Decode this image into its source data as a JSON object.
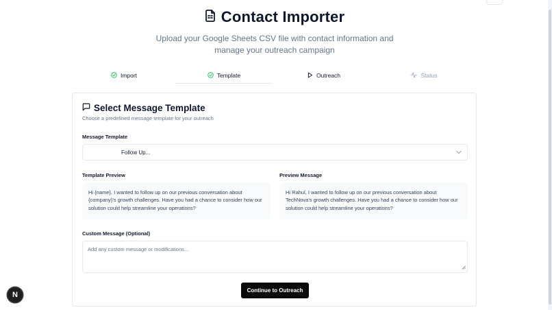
{
  "header": {
    "title": "Contact Importer",
    "title_icon": "file-text-icon",
    "subtitle": "Upload your Google Sheets CSV file with contact information and manage your outreach campaign"
  },
  "steps": [
    {
      "label": "Import",
      "icon": "check-circle-icon",
      "state": "complete"
    },
    {
      "label": "Template",
      "icon": "check-circle-icon",
      "state": "active"
    },
    {
      "label": "Outreach",
      "icon": "play-icon",
      "state": "pending"
    },
    {
      "label": "Status",
      "icon": "activity-icon",
      "state": "disabled"
    }
  ],
  "card": {
    "title": "Select Message Template",
    "title_icon": "message-square-icon",
    "description": "Choose a predefined message template for your outreach"
  },
  "template_select": {
    "label": "Message Template",
    "value": "Follow Up..."
  },
  "template_preview": {
    "label": "Template Preview",
    "text": "Hi {name}, I wanted to follow up on our previous conversation about {company}'s growth challenges. Have you had a chance to consider how our solution could help streamline your operations?"
  },
  "preview_message": {
    "label": "Preview Message",
    "text": "Hi Rahul, I wanted to follow up on our previous conversation about TechNova's growth challenges. Have you had a chance to consider how our solution could help streamline your operations?"
  },
  "custom_message": {
    "label": "Custom Message (Optional)",
    "placeholder": "Add any custom message or modifications..."
  },
  "continue_button": {
    "label": "Continue to Outreach"
  },
  "dev_badge": {
    "letter": "N"
  },
  "colors": {
    "accent_success": "#22c55e",
    "primary_button": "#0a0a0a",
    "muted_text": "#64748b"
  }
}
